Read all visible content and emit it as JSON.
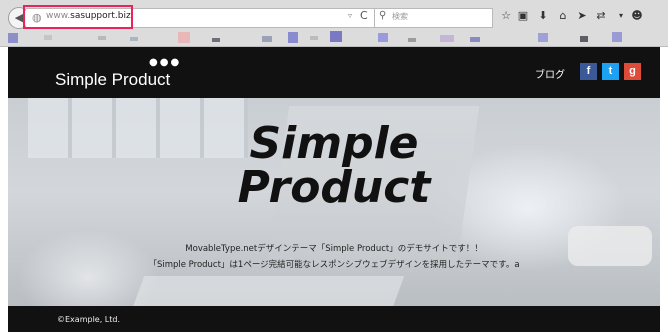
{
  "browser": {
    "url_prefix": "www.",
    "url_domain": "sasupport.biz",
    "search_placeholder": "検索",
    "icons": [
      "back-icon",
      "globe-icon",
      "dropdown-icon",
      "reload-icon",
      "search-icon",
      "star-icon",
      "clipboard-icon",
      "download-icon",
      "home-icon",
      "send-icon",
      "extension-icon",
      "menu-icon",
      "chat-icon"
    ]
  },
  "site": {
    "logo_dots": "●●●",
    "title": "Simple Product",
    "nav_blog": "ブログ",
    "social": {
      "facebook": "f",
      "twitter": "t",
      "google": "g"
    },
    "colors": {
      "header_bg": "#111111",
      "facebook": "#3b5998",
      "twitter": "#1da1f2",
      "google": "#dd4b39"
    }
  },
  "hero": {
    "title_line1": "Simple",
    "title_line2": "Product",
    "desc_line1": "MovableType.netデザインテーマ「Simple Product」のデモサイトです！！",
    "desc_line2": "「Simple Product」は1ページ完結可能なレスポンシブウェブデザインを採用したテーマです。a"
  },
  "footer": {
    "copyright": "©Example, Ltd."
  }
}
